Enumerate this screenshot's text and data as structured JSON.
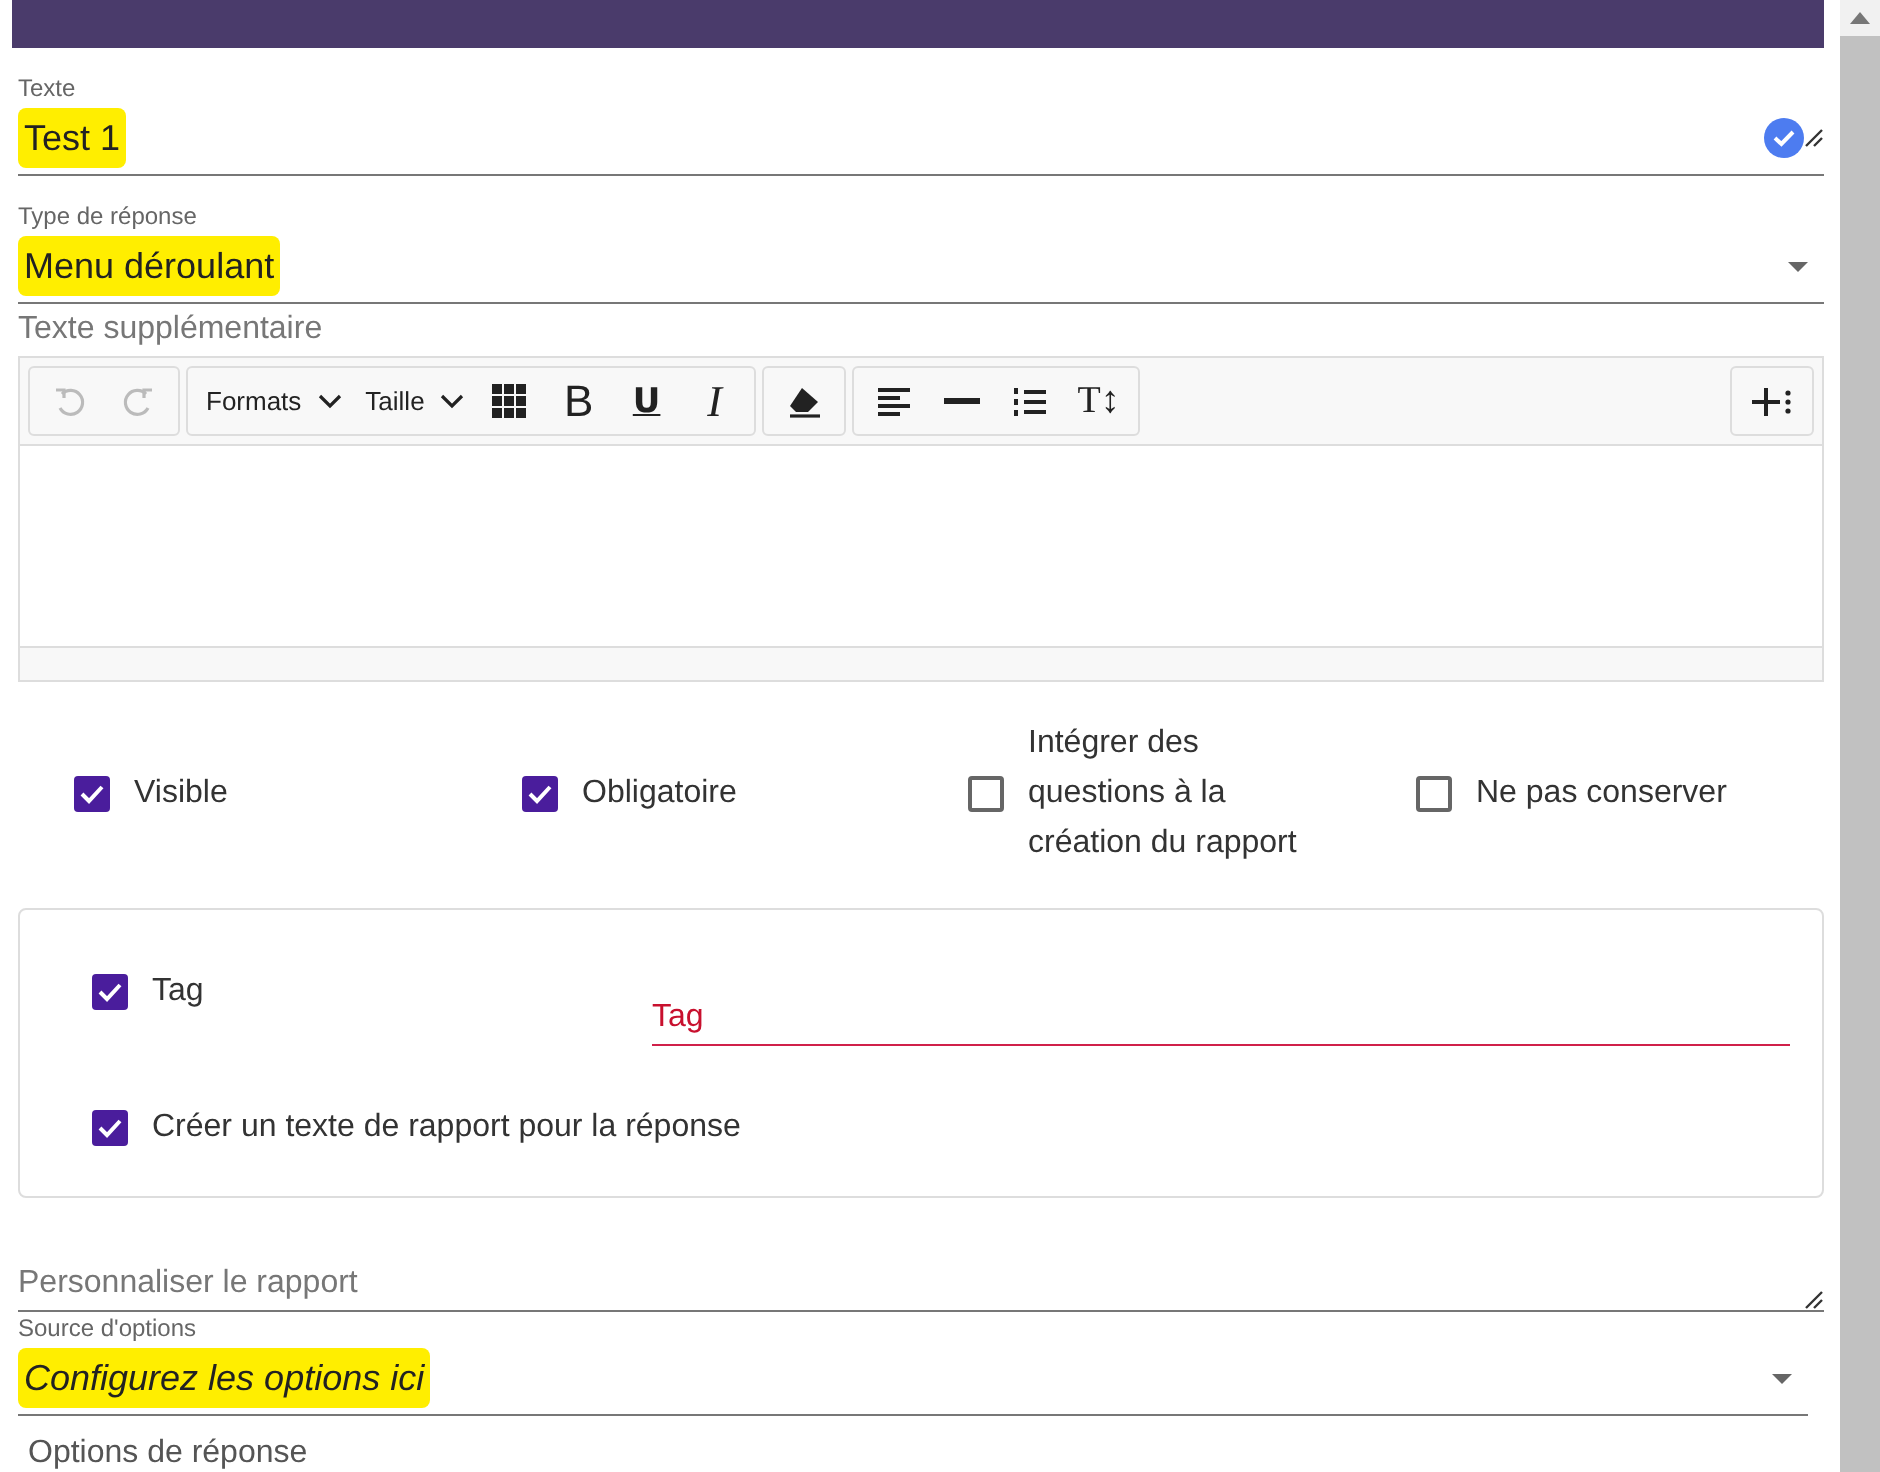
{
  "fields_top": [
    {
      "kind": "text",
      "label": "Texte",
      "value": "Test 1",
      "highlighted": true,
      "valid": true
    },
    {
      "kind": "select",
      "label": "Type de réponse",
      "value": "Menu déroulant",
      "highlighted": true,
      "valid": false
    }
  ],
  "editor": {
    "label": "Texte supplémentaire",
    "groups": [
      {
        "items": [
          {
            "kind": "undo",
            "disabled": true
          },
          {
            "kind": "redo",
            "disabled": true
          }
        ]
      },
      {
        "items": [
          {
            "kind": "select",
            "label": "Formats"
          },
          {
            "kind": "select",
            "label": "Taille"
          },
          {
            "kind": "grid"
          },
          {
            "kind": "bold",
            "label": "B"
          },
          {
            "kind": "underline",
            "label": "U"
          },
          {
            "kind": "italic",
            "label": "I"
          }
        ]
      },
      {
        "items": [
          {
            "kind": "eraser"
          }
        ]
      },
      {
        "items": [
          {
            "kind": "align"
          },
          {
            "kind": "rule"
          },
          {
            "kind": "list"
          },
          {
            "kind": "textsize",
            "label": "T↕"
          }
        ]
      }
    ],
    "end_items": [
      {
        "kind": "insert"
      }
    ]
  },
  "options": [
    {
      "label": "Visible",
      "checked": true
    },
    {
      "label": "Obligatoire",
      "checked": true
    },
    {
      "label": "Intégrer des questions à la création du rapport",
      "checked": false
    },
    {
      "label": "Ne pas conserver",
      "checked": false
    }
  ],
  "card": {
    "tag": {
      "label": "Tag",
      "checked": true,
      "placeholder": "Tag",
      "invalid": true
    },
    "report_text": {
      "label": "Créer un texte de rapport pour la réponse",
      "checked": true
    }
  },
  "customize": {
    "placeholder": "Personnaliser le rapport"
  },
  "source": {
    "label": "Source d'options",
    "value": "Configurez les options ici",
    "highlighted": true
  },
  "next_section": {
    "label": "Options de réponse"
  }
}
